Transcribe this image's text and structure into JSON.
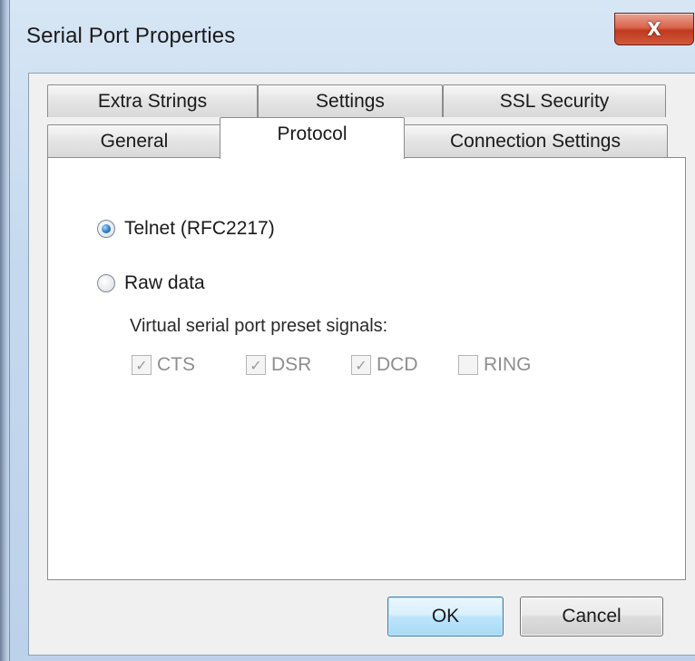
{
  "window": {
    "title": "Serial Port Properties",
    "close_glyph": "X"
  },
  "tabs": {
    "row_top": [
      {
        "label": "Extra Strings"
      },
      {
        "label": "Settings"
      },
      {
        "label": "SSL Security"
      }
    ],
    "row_bottom": [
      {
        "label": "General"
      },
      {
        "label": "Protocol",
        "selected": true
      },
      {
        "label": "Connection Settings"
      }
    ]
  },
  "protocol": {
    "options": [
      {
        "label": "Telnet (RFC2217)",
        "selected": true
      },
      {
        "label": "Raw data",
        "selected": false
      }
    ],
    "signals_label": "Virtual serial port preset signals:",
    "signals": [
      {
        "label": "CTS",
        "checked": true,
        "enabled": false
      },
      {
        "label": "DSR",
        "checked": true,
        "enabled": false
      },
      {
        "label": "DCD",
        "checked": true,
        "enabled": false
      },
      {
        "label": "RING",
        "checked": false,
        "enabled": false
      }
    ]
  },
  "buttons": {
    "ok_label": "OK",
    "cancel_label": "Cancel"
  },
  "colors": {
    "accent": "#2c7ec9",
    "disabled_text": "#8e8e8e"
  }
}
